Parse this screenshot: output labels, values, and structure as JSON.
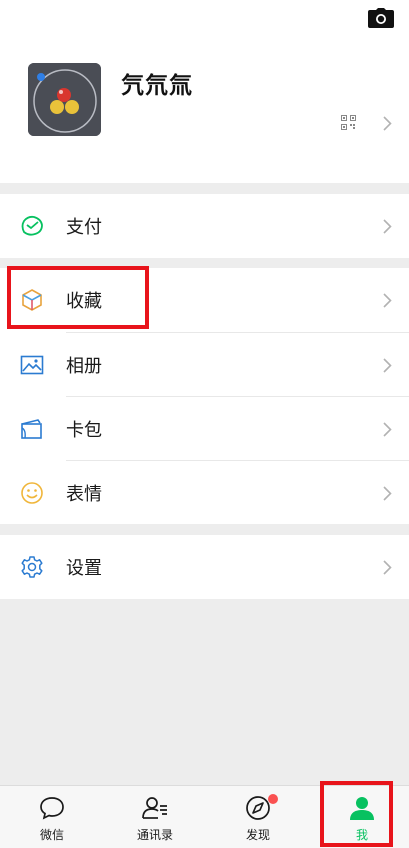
{
  "profile": {
    "nickname": "氕氘氚",
    "camera_icon": "camera-icon",
    "qr_icon": "qrcode-icon"
  },
  "menu": {
    "pay": {
      "label": "支付",
      "icon": "wallet-check-icon",
      "icon_color": "#07c160"
    },
    "favorites": {
      "label": "收藏",
      "icon": "cube-icon",
      "icon_color": "#e8a33d"
    },
    "album": {
      "label": "相册",
      "icon": "picture-icon",
      "icon_color": "#2b7bd1"
    },
    "cards": {
      "label": "卡包",
      "icon": "card-icon",
      "icon_color": "#2b7bd1"
    },
    "stickers": {
      "label": "表情",
      "icon": "smiley-icon",
      "icon_color": "#f0b63b"
    },
    "settings": {
      "label": "设置",
      "icon": "gear-icon",
      "icon_color": "#2b7bd1"
    }
  },
  "tabbar": {
    "chats": {
      "label": "微信",
      "icon": "chat-bubble-icon"
    },
    "contacts": {
      "label": "通讯录",
      "icon": "contacts-icon"
    },
    "discover": {
      "label": "发现",
      "icon": "compass-icon",
      "badge_dot": true
    },
    "me": {
      "label": "我",
      "icon": "person-icon",
      "active": true
    }
  },
  "colors": {
    "accent": "#07c160",
    "highlight_box": "#e8141b",
    "badge": "#fa5151",
    "background": "#ededed"
  }
}
